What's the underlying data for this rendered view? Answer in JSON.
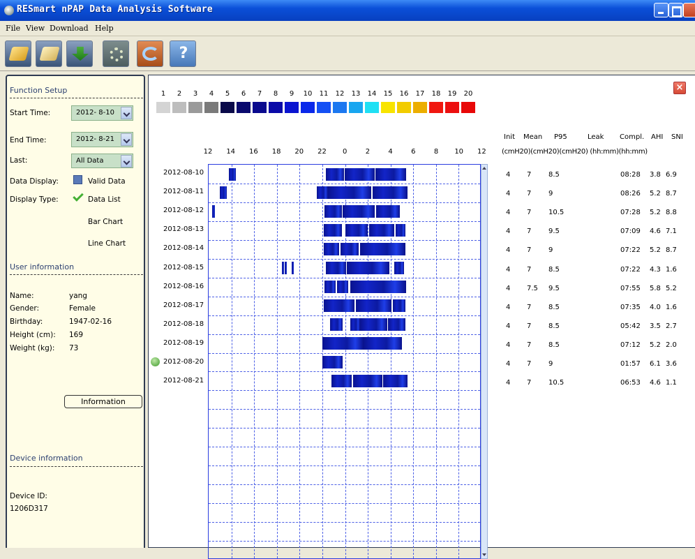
{
  "window": {
    "title": "RESmart nPAP Data Analysis Software"
  },
  "menu": {
    "file": "File",
    "view": "View",
    "download": "Download",
    "help": "Help"
  },
  "toolbar": {
    "icons": [
      "open-icon",
      "save-icon",
      "download-icon",
      "settings-icon",
      "refresh-icon",
      "help-icon"
    ]
  },
  "function_setup": {
    "title": "Function Setup",
    "start_label": "Start Time:",
    "start_value": "2012- 8-10",
    "end_label": "End Time:",
    "end_value": "2012- 8-21",
    "last_label": "Last:",
    "last_value": "All Data",
    "data_display_label": "Data Display:",
    "data_display_value": "Valid Data",
    "display_type_label": "Display Type:",
    "display_types": [
      "Data List",
      "Bar Chart",
      "Line Chart"
    ]
  },
  "user_info": {
    "title": "User information",
    "fields": [
      {
        "label": "Name:",
        "value": "yang"
      },
      {
        "label": "Gender:",
        "value": "Female"
      },
      {
        "label": "Birthday:",
        "value": "1947-02-16"
      },
      {
        "label": "Height (cm):",
        "value": "169"
      },
      {
        "label": "Weight (kg):",
        "value": "73"
      }
    ],
    "button": "Information"
  },
  "device_info": {
    "title": "Device information",
    "id_label": "Device ID:",
    "id_value": "1206D317"
  },
  "legend": {
    "numbers": [
      "1",
      "2",
      "3",
      "4",
      "5",
      "6",
      "7",
      "8",
      "9",
      "10",
      "11",
      "12",
      "13",
      "14",
      "15",
      "16",
      "17",
      "18",
      "19",
      "20"
    ],
    "colors": [
      "#d4d4d4",
      "#bdbdbd",
      "#9a9a9a",
      "#7a7a7a",
      "#0a0a4a",
      "#0a0a6e",
      "#0a0a8e",
      "#0a0aa8",
      "#0a14d0",
      "#0a28ea",
      "#1450f4",
      "#1c78f0",
      "#18a6f0",
      "#20e0f4",
      "#f8e400",
      "#f2cc00",
      "#ecae00",
      "#f01810",
      "#ec1010",
      "#e80808"
    ]
  },
  "hours": [
    "12",
    "14",
    "16",
    "18",
    "20",
    "22",
    "0",
    "2",
    "4",
    "6",
    "8",
    "10",
    "12"
  ],
  "table": {
    "headers": {
      "init": "Init",
      "mean": "Mean",
      "p95": "P95",
      "leak": "Leak",
      "compl": "Compl.",
      "ahi": "AHI",
      "sni": "SNI"
    },
    "units": "(cmH20)(cmH20)(cmH20) (hh:mm)(hh:mm)",
    "rows": [
      {
        "date": "2012-08-10",
        "init": "4",
        "mean": "7",
        "p95": "8.5",
        "leak": "",
        "compl": "08:28",
        "ahi": "3.8",
        "sni": "6.9"
      },
      {
        "date": "2012-08-11",
        "init": "4",
        "mean": "7",
        "p95": "9",
        "leak": "",
        "compl": "08:26",
        "ahi": "5.2",
        "sni": "8.7"
      },
      {
        "date": "2012-08-12",
        "init": "4",
        "mean": "7",
        "p95": "10.5",
        "leak": "",
        "compl": "07:28",
        "ahi": "5.2",
        "sni": "8.8"
      },
      {
        "date": "2012-08-13",
        "init": "4",
        "mean": "7",
        "p95": "9.5",
        "leak": "",
        "compl": "07:09",
        "ahi": "4.6",
        "sni": "7.1"
      },
      {
        "date": "2012-08-14",
        "init": "4",
        "mean": "7",
        "p95": "9",
        "leak": "",
        "compl": "07:22",
        "ahi": "5.2",
        "sni": "8.7"
      },
      {
        "date": "2012-08-15",
        "init": "4",
        "mean": "7",
        "p95": "8.5",
        "leak": "",
        "compl": "07:22",
        "ahi": "4.3",
        "sni": "1.6"
      },
      {
        "date": "2012-08-16",
        "init": "4",
        "mean": "7.5",
        "p95": "9.5",
        "leak": "",
        "compl": "07:55",
        "ahi": "5.8",
        "sni": "5.2"
      },
      {
        "date": "2012-08-17",
        "init": "4",
        "mean": "7",
        "p95": "8.5",
        "leak": "",
        "compl": "07:35",
        "ahi": "4.0",
        "sni": "1.6"
      },
      {
        "date": "2012-08-18",
        "init": "4",
        "mean": "7",
        "p95": "8.5",
        "leak": "",
        "compl": "05:42",
        "ahi": "3.5",
        "sni": "2.7"
      },
      {
        "date": "2012-08-19",
        "init": "4",
        "mean": "7",
        "p95": "8.5",
        "leak": "",
        "compl": "07:12",
        "ahi": "5.2",
        "sni": "2.0"
      },
      {
        "date": "2012-08-20",
        "init": "4",
        "mean": "7",
        "p95": "9",
        "leak": "",
        "compl": "01:57",
        "ahi": "6.1",
        "sni": "3.6"
      },
      {
        "date": "2012-08-21",
        "init": "4",
        "mean": "7",
        "p95": "10.5",
        "leak": "",
        "compl": "06:53",
        "ahi": "4.6",
        "sni": "1.1"
      }
    ]
  },
  "sessions": [
    [
      [
        13.8,
        14.4
      ],
      [
        22.3,
        23.9
      ],
      [
        23.95,
        2.6
      ],
      [
        2.7,
        5.4
      ]
    ],
    [
      [
        13.0,
        13.6
      ],
      [
        21.5,
        22.5
      ],
      [
        22.5,
        2.3
      ],
      [
        2.4,
        5.5
      ]
    ],
    [
      [
        12.3,
        12.55
      ],
      [
        22.2,
        23.7
      ],
      [
        23.8,
        2.6
      ],
      [
        2.75,
        4.8
      ]
    ],
    [
      [
        22.1,
        23.7
      ],
      [
        0.0,
        2.0
      ],
      [
        2.1,
        4.35
      ],
      [
        4.45,
        5.3
      ]
    ],
    [
      [
        22.1,
        23.5
      ],
      [
        23.6,
        1.2
      ],
      [
        1.3,
        5.3
      ]
    ],
    [
      [
        18.45,
        18.55
      ],
      [
        18.7,
        18.85
      ],
      [
        19.3,
        19.45
      ],
      [
        22.3,
        0.1
      ],
      [
        0.15,
        3.9
      ],
      [
        4.3,
        5.2
      ]
    ],
    [
      [
        22.2,
        23.2
      ],
      [
        23.3,
        0.3
      ],
      [
        0.45,
        5.4
      ]
    ],
    [
      [
        22.1,
        0.85
      ],
      [
        0.95,
        4.1
      ],
      [
        4.2,
        5.3
      ]
    ],
    [
      [
        22.7,
        23.8
      ],
      [
        0.45,
        1.3
      ],
      [
        1.35,
        3.7
      ],
      [
        3.75,
        5.3
      ]
    ],
    [
      [
        22.0,
        1.6
      ],
      [
        1.65,
        5.0
      ]
    ],
    [
      [
        22.0,
        23.8
      ]
    ],
    [
      [
        22.8,
        0.6
      ],
      [
        0.7,
        3.3
      ],
      [
        3.35,
        5.5
      ]
    ]
  ]
}
